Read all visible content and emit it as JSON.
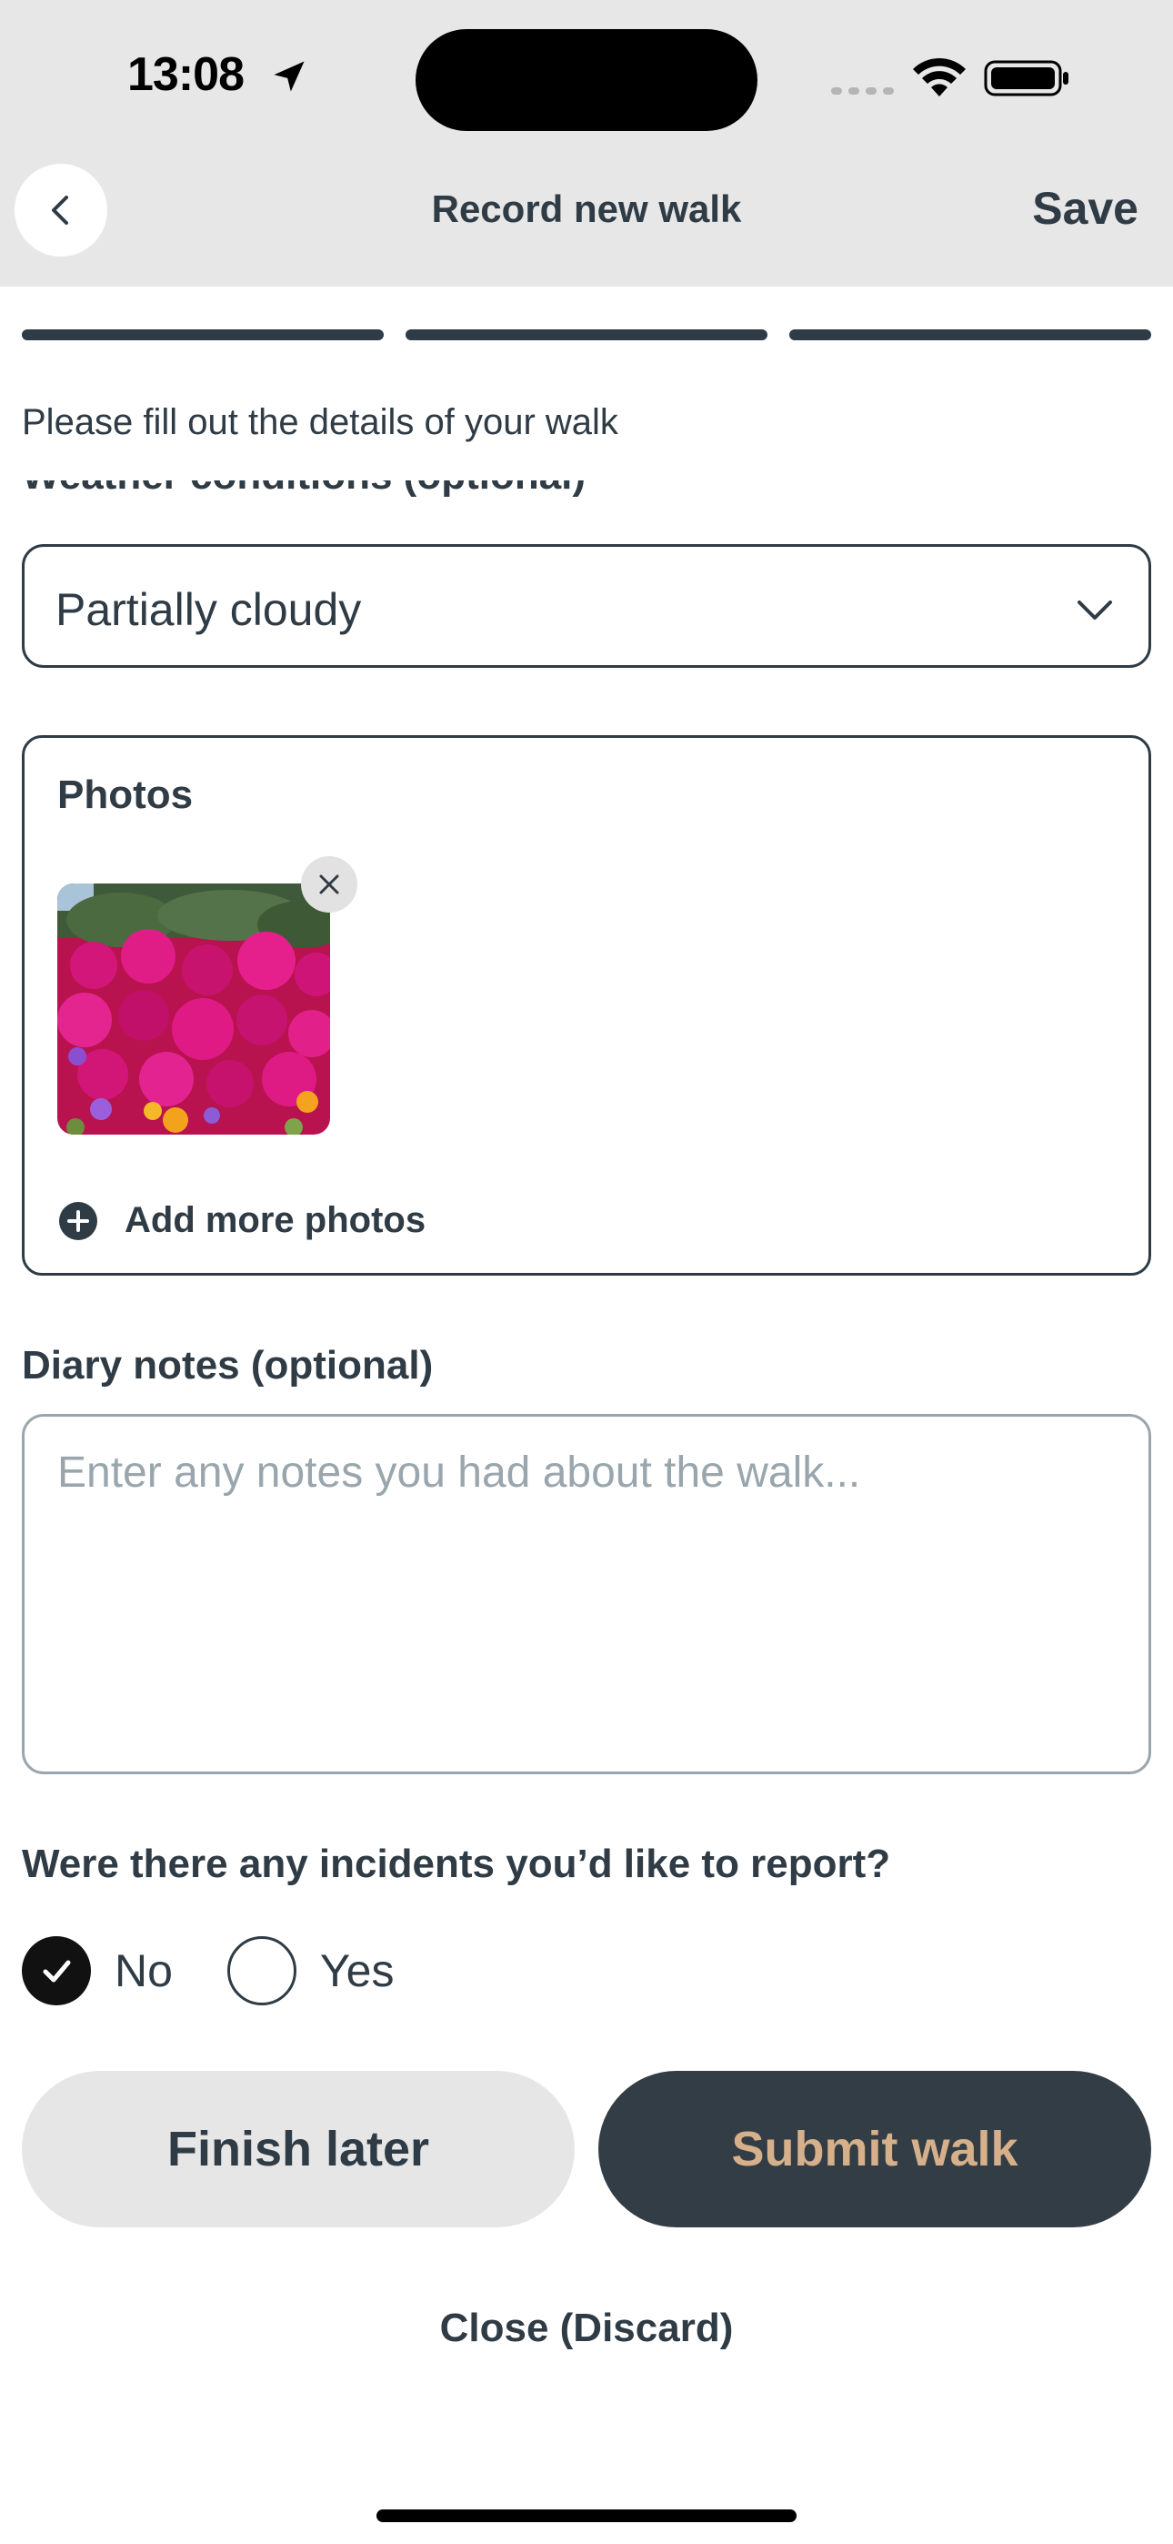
{
  "status_bar": {
    "time": "13:08"
  },
  "header": {
    "title": "Record new walk",
    "save_label": "Save"
  },
  "progress": {
    "steps_total": 3,
    "steps_completed": 3
  },
  "intro_text": "Please fill out the details of your walk",
  "weather": {
    "label": "Weather conditions (optional)",
    "value": "Partially cloudy"
  },
  "photos": {
    "title": "Photos",
    "count": 1,
    "add_more_label": "Add more photos"
  },
  "notes": {
    "label": "Diary notes (optional)",
    "placeholder": "Enter any notes you had about the walk...",
    "value": ""
  },
  "incidents": {
    "question": "Were there any incidents you’d like to report?",
    "options": [
      {
        "label": "No",
        "selected": true
      },
      {
        "label": "Yes",
        "selected": false
      }
    ]
  },
  "actions": {
    "finish_later": "Finish later",
    "submit": "Submit walk",
    "discard": "Close (Discard)"
  },
  "colors": {
    "primary": "#2f3b45",
    "submit_bg": "#333d46",
    "submit_text": "#d6b08a",
    "header_bg": "#e7e7e7"
  }
}
